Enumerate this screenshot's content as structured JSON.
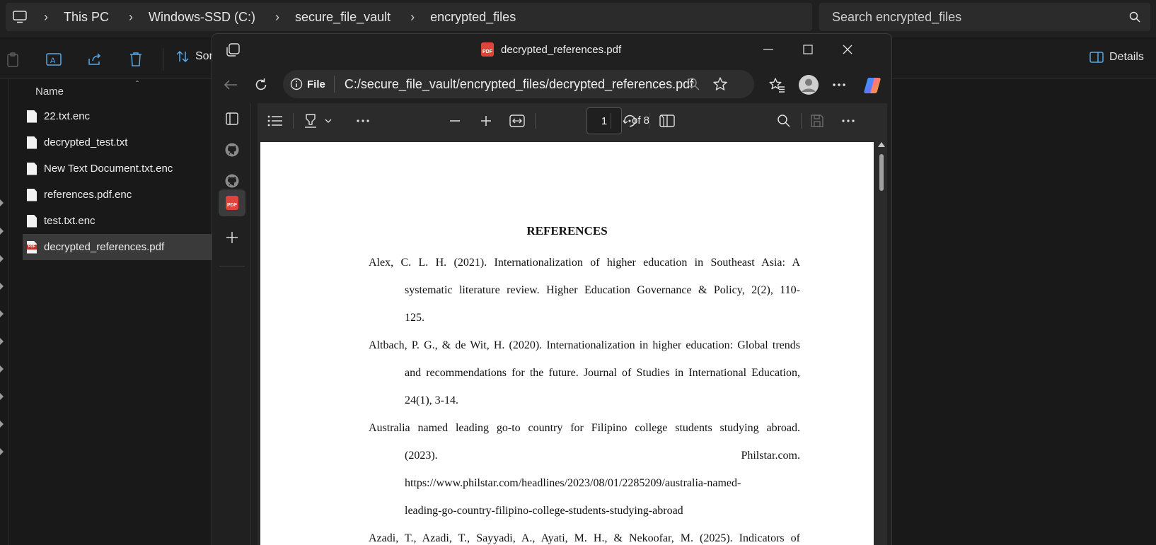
{
  "explorer": {
    "breadcrumbs": [
      "This PC",
      "Windows-SSD (C:)",
      "secure_file_vault",
      "encrypted_files"
    ],
    "search_placeholder": "Search encrypted_files",
    "sort_label": "Sort",
    "details_label": "Details",
    "column_name": "Name",
    "files": [
      {
        "name": "22.txt.enc",
        "type": "file"
      },
      {
        "name": "decrypted_test.txt",
        "type": "text"
      },
      {
        "name": "New Text Document.txt.enc",
        "type": "file"
      },
      {
        "name": "references.pdf.enc",
        "type": "file"
      },
      {
        "name": "test.txt.enc",
        "type": "file"
      },
      {
        "name": "decrypted_references.pdf",
        "type": "pdf",
        "selected": true
      }
    ]
  },
  "browser": {
    "window_title": "decrypted_references.pdf",
    "file_label": "File",
    "url": "C:/secure_file_vault/encrypted_files/decrypted_references.pdf",
    "pdf_badge": "PDF"
  },
  "pdf_toolbar": {
    "current_page": "1",
    "page_count_label": "of 8"
  },
  "document": {
    "heading": "REFERENCES",
    "references": [
      {
        "lines": [
          "Alex, C. L. H. (2021). Internationalization of higher education in Southeast Asia: A",
          "systematic literature review. Higher Education Governance & Policy, 2(2), 110-",
          "125."
        ]
      },
      {
        "lines": [
          "Altbach, P. G., & de Wit, H. (2020). Internationalization in higher education: Global trends",
          "and recommendations for the future. Journal of Studies in International Education,",
          "24(1), 3-14."
        ]
      },
      {
        "lines": [
          "Australia named leading go-to country for Filipino college students studying abroad.",
          "(2023).",
          "Philstar.com.",
          "https://www.philstar.com/headlines/2023/08/01/2285209/australia-named-",
          "leading-go-country-filipino-college-students-studying-abroad"
        ]
      },
      {
        "lines": [
          "Azadi, T., Azadi, T., Sayyadi, A., Ayati, M. H., & Nekoofar, M. (2025). Indicators of"
        ]
      }
    ]
  },
  "colors": {
    "explorer_bg": "#191919",
    "selection": "#3a3a3a",
    "pdf_red": "#e0433a",
    "copilot_gradient": [
      "#2ea6ff",
      "#ff5ab4",
      "#ffb020"
    ]
  }
}
